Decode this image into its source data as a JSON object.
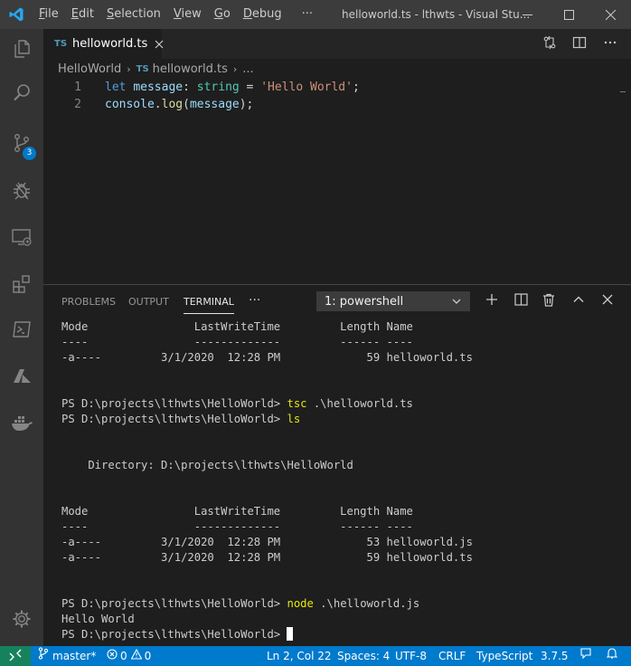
{
  "window": {
    "title": "helloworld.ts - lthwts - Visual Stu...",
    "menu": [
      {
        "first": "F",
        "rest": "ile"
      },
      {
        "first": "E",
        "rest": "dit"
      },
      {
        "first": "S",
        "rest": "election"
      },
      {
        "first": "V",
        "rest": "iew"
      },
      {
        "first": "G",
        "rest": "o"
      },
      {
        "first": "D",
        "rest": "ebug"
      }
    ],
    "menu_more": "···"
  },
  "activity": {
    "scm_badge": "3"
  },
  "tab": {
    "lang_badge": "TS",
    "label": "helloworld.ts"
  },
  "breadcrumb": {
    "folder": "HelloWorld",
    "lang_badge": "TS",
    "file": "helloworld.ts",
    "more": "..."
  },
  "editor": {
    "lines": [
      {
        "number": "1",
        "tokens": [
          {
            "cls": "kw",
            "text": "let "
          },
          {
            "cls": "id",
            "text": "message"
          },
          {
            "cls": "pl",
            "text": ": "
          },
          {
            "cls": "ty",
            "text": "string"
          },
          {
            "cls": "pl",
            "text": " = "
          },
          {
            "cls": "str",
            "text": "'Hello World'"
          },
          {
            "cls": "pl",
            "text": ";"
          }
        ]
      },
      {
        "number": "2",
        "tokens": [
          {
            "cls": "id",
            "text": "console"
          },
          {
            "cls": "pl",
            "text": "."
          },
          {
            "cls": "fn",
            "text": "log"
          },
          {
            "cls": "pl",
            "text": "("
          },
          {
            "cls": "id",
            "text": "message"
          },
          {
            "cls": "pl",
            "text": ");"
          }
        ]
      }
    ]
  },
  "panel": {
    "tabs": {
      "problems": "PROBLEMS",
      "output": "OUTPUT",
      "terminal": "TERMINAL"
    },
    "more": "···",
    "selected_terminal": "1: powershell"
  },
  "terminal": {
    "lines": [
      {
        "text": "Mode                LastWriteTime         Length Name"
      },
      {
        "text": "----                -------------         ------ ----"
      },
      {
        "text": "-a----         3/1/2020  12:28 PM             59 helloworld.ts"
      },
      {
        "text": ""
      },
      {
        "text": ""
      },
      {
        "prompt": "PS D:\\projects\\lthwts\\HelloWorld> ",
        "cmd": "tsc",
        "args": " .\\helloworld.ts"
      },
      {
        "prompt": "PS D:\\projects\\lthwts\\HelloWorld> ",
        "cmd": "ls",
        "args": ""
      },
      {
        "text": ""
      },
      {
        "text": ""
      },
      {
        "text": "    Directory: D:\\projects\\lthwts\\HelloWorld"
      },
      {
        "text": ""
      },
      {
        "text": ""
      },
      {
        "text": "Mode                LastWriteTime         Length Name"
      },
      {
        "text": "----                -------------         ------ ----"
      },
      {
        "text": "-a----         3/1/2020  12:28 PM             53 helloworld.js"
      },
      {
        "text": "-a----         3/1/2020  12:28 PM             59 helloworld.ts"
      },
      {
        "text": ""
      },
      {
        "text": ""
      },
      {
        "prompt": "PS D:\\projects\\lthwts\\HelloWorld> ",
        "cmd": "node",
        "args": " .\\helloworld.js"
      },
      {
        "text": "Hello World"
      },
      {
        "prompt": "PS D:\\projects\\lthwts\\HelloWorld> ",
        "cmd": "",
        "args": "",
        "cursor": true
      }
    ]
  },
  "status": {
    "branch": "master*",
    "errors": "0",
    "warnings": "0",
    "position": "Ln 2, Col 22",
    "spaces": "Spaces: 4",
    "encoding": "UTF-8",
    "eol": "CRLF",
    "language": "TypeScript",
    "version": "3.7.5"
  },
  "colors": {
    "accent": "#007acc",
    "remote": "#16825d",
    "terminal_command": "#e5e510"
  }
}
